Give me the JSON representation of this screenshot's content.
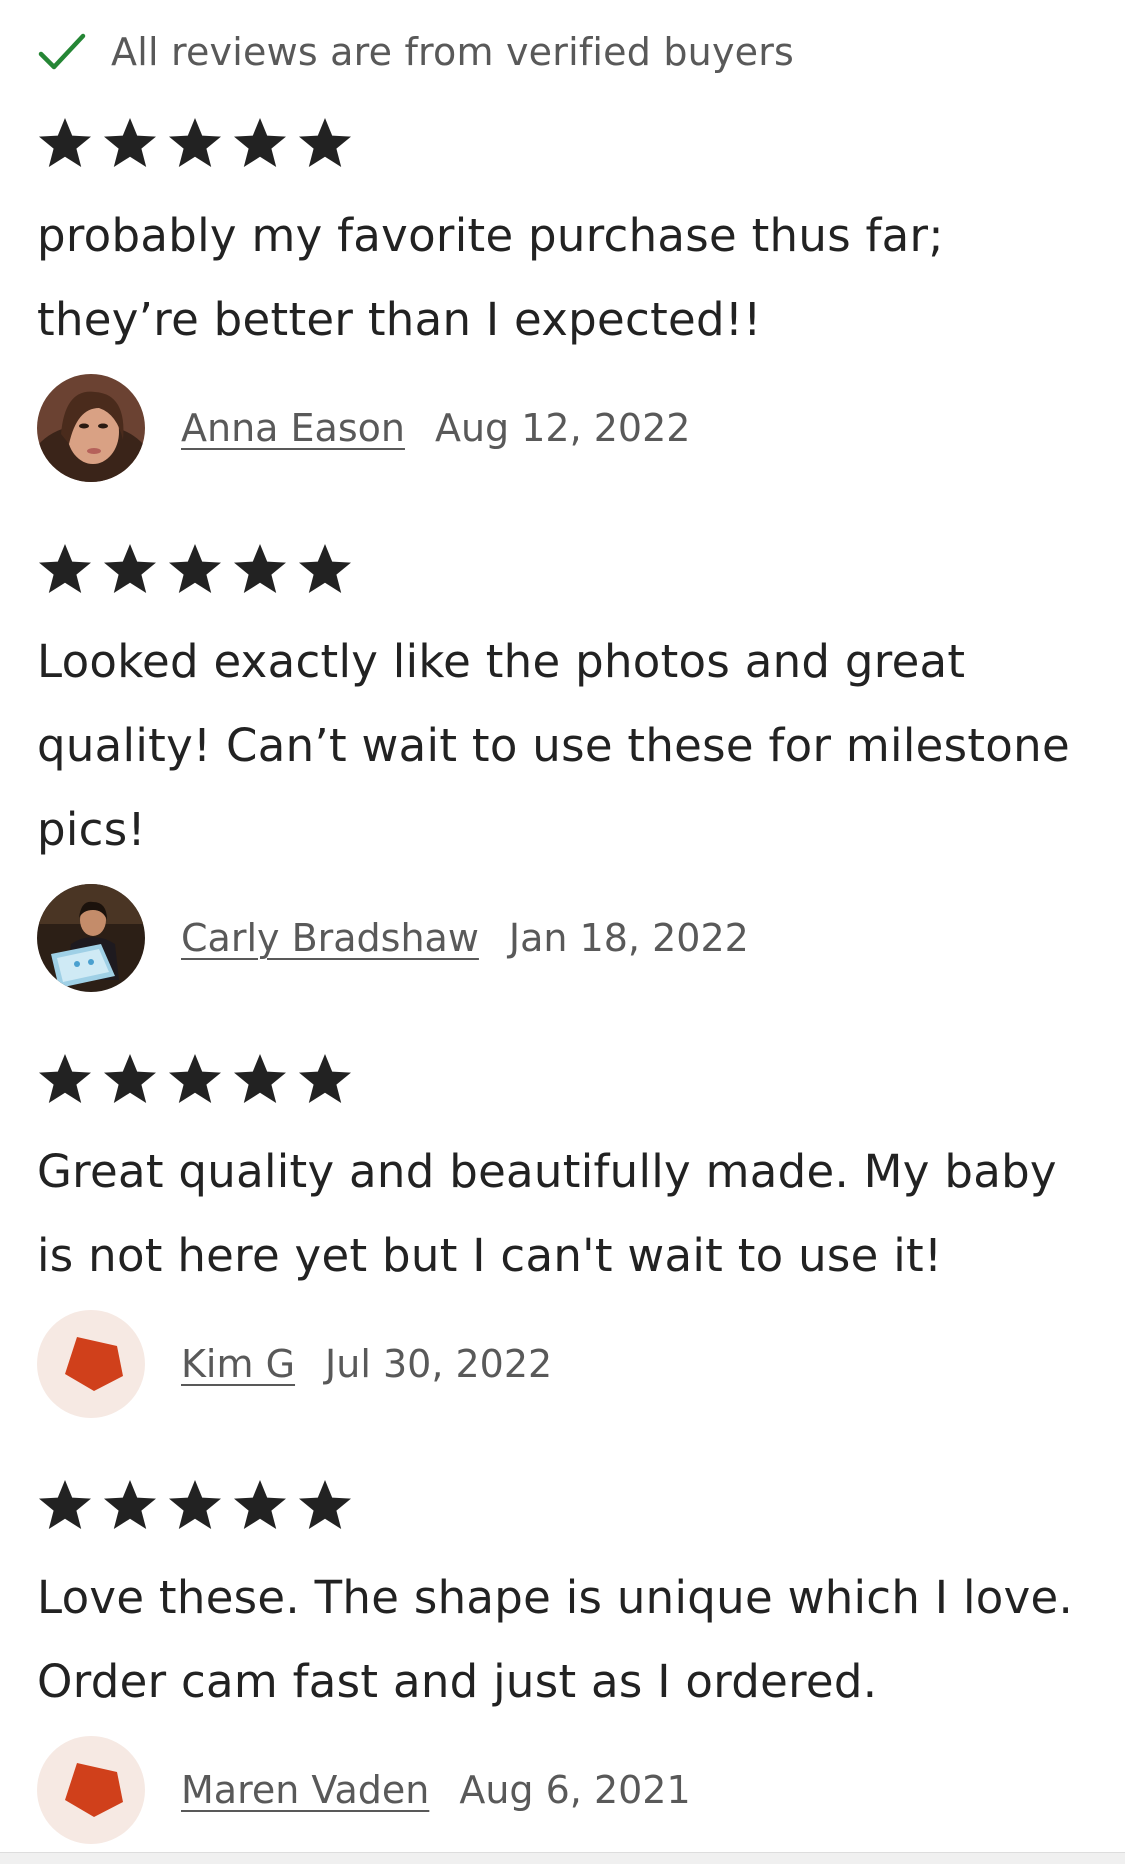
{
  "verified_banner": {
    "text": "All reviews are from verified buyers",
    "icon": "check-icon",
    "icon_color": "#258635"
  },
  "colors": {
    "star": "#222222",
    "meta_text": "#595959",
    "default_avatar_bg": "#F6E9E3",
    "default_avatar_shape": "#D0401B"
  },
  "reviews": [
    {
      "rating": 5,
      "text": "probably my favorite purchase thus far; they’re better than I expected!!",
      "reviewer": "Anna Eason",
      "date": "Aug 12, 2022",
      "avatar": "photo"
    },
    {
      "rating": 5,
      "text": "Looked exactly like the photos and great quality! Can’t wait to use these for milestone pics!",
      "reviewer": "Carly Bradshaw",
      "date": "Jan 18, 2022",
      "avatar": "photo"
    },
    {
      "rating": 5,
      "text": "Great quality and beautifully made. My baby is not here yet but I can't wait to use it!",
      "reviewer": "Kim G",
      "date": "Jul 30, 2022",
      "avatar": "default-shape"
    },
    {
      "rating": 5,
      "text": "Love these. The shape is unique which I love. Order cam fast and just as I ordered.",
      "reviewer": "Maren Vaden",
      "date": "Aug 6, 2021",
      "avatar": "default-shape"
    }
  ]
}
